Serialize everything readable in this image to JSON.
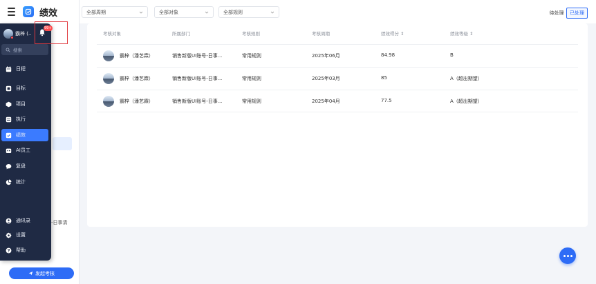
{
  "app": {
    "title": "绩效"
  },
  "profile": {
    "name": "霸梓 (...",
    "badge": "99+"
  },
  "nav": {
    "search_placeholder": "搜索",
    "items": [
      {
        "key": "schedule",
        "label": "日程"
      },
      {
        "key": "goals",
        "label": "目标"
      },
      {
        "key": "projects",
        "label": "项目"
      },
      {
        "key": "execution",
        "label": "执行"
      },
      {
        "key": "performance",
        "label": "绩效"
      },
      {
        "key": "ai-staff",
        "label": "AI员工"
      },
      {
        "key": "review",
        "label": "复盘"
      },
      {
        "key": "stats",
        "label": "统计"
      },
      {
        "key": "contacts",
        "label": "通讯录"
      },
      {
        "key": "settings",
        "label": "设置"
      },
      {
        "key": "help",
        "label": "帮助"
      }
    ],
    "overflow_text": "-日事清"
  },
  "start_button": {
    "label": "发起考核"
  },
  "filters": {
    "period": "全部周期",
    "target": "全部对象",
    "rule": "全部规则"
  },
  "status_toggle": {
    "pending": "待处理",
    "done": "已处理"
  },
  "table": {
    "headers": [
      "考核对象",
      "所属部门",
      "考核规则",
      "考核周期",
      "绩效得分 ⇕",
      "绩效等级 ⇕"
    ],
    "rows": [
      {
        "target": "霸梓（潘艺霖）",
        "department": "销售新版UI账号-日事...",
        "rule": "常用规则",
        "period": "2025年06月",
        "score": "84.98",
        "grade": "B"
      },
      {
        "target": "霸梓（潘艺霖）",
        "department": "销售新版UI账号-日事...",
        "rule": "常用规则",
        "period": "2025年03月",
        "score": "85",
        "grade": "A（超出期望）"
      },
      {
        "target": "霸梓（潘艺霖）",
        "department": "销售新版UI账号-日事...",
        "rule": "常用规则",
        "period": "2025年04月",
        "score": "77.5",
        "grade": "A（超出期望）"
      }
    ]
  },
  "colors": {
    "accent": "#2e6cf6",
    "menu_bg": "#1f2a44",
    "badge": "#ff4d4f"
  }
}
